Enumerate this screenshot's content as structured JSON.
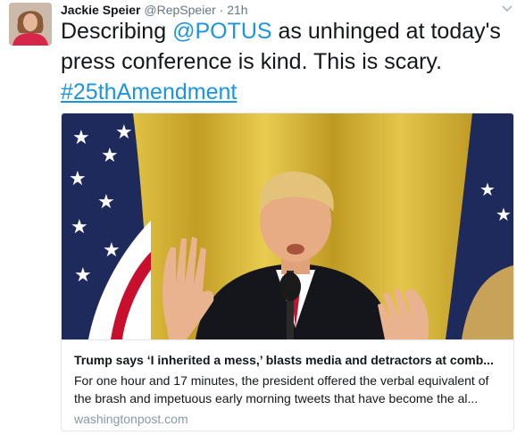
{
  "tweet": {
    "author_name": "Jackie Speier",
    "author_handle": "@RepSpeier",
    "separator": "·",
    "time": "21h",
    "text_line1_before": "Describing ",
    "text_mention": "@POTUS",
    "text_line1_after": " as unhinged at today's",
    "text_line2": "press conference is kind. This is scary.",
    "hashtag": "#25thAmendment"
  },
  "card": {
    "title": "Trump says ‘I inherited a mess,’ blasts media and detractors at comb...",
    "description_line1": "For one hour and 17 minutes, the president offered the verbal equivalent of",
    "description_line2": "the brash and impetuous early morning tweets that have become the al...",
    "domain": "washingtonpost.com"
  },
  "icons": {
    "caret": "chevron-down-icon",
    "avatar": "avatar-photo"
  },
  "colors": {
    "link": "#1b95e0",
    "text": "#14171a",
    "muted": "#657786",
    "domain": "#8899a6",
    "border": "#e1e8ed"
  }
}
